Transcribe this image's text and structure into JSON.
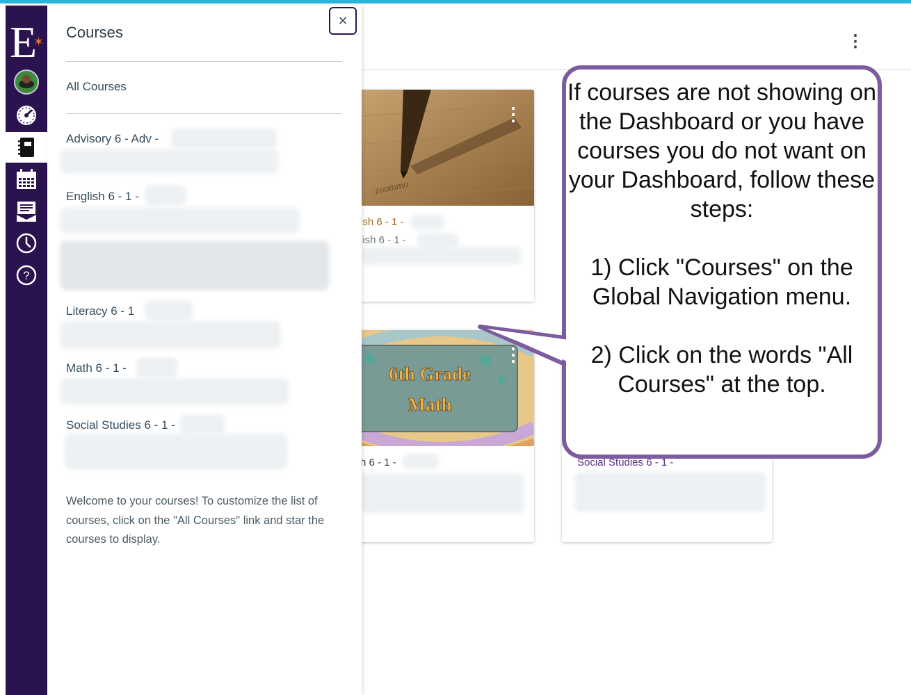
{
  "tray": {
    "title": "Courses",
    "close_label": "×",
    "all_courses": "All Courses",
    "courses": [
      "Advisory 6 - Adv -",
      "English 6 - 1 -",
      "Literacy 6 - 1",
      "Math 6 - 1 -",
      "Social Studies 6 - 1 -"
    ],
    "welcome": "Welcome to your courses! To customize the list of courses, click on the \"All Courses\" link and star the courses to display."
  },
  "nav": {
    "logo_letter": "E",
    "items": [
      "account-avatar",
      "dashboard-icon",
      "courses-icon",
      "calendar-icon",
      "inbox-icon",
      "history-icon",
      "help-icon"
    ],
    "active": "courses-icon",
    "colors": {
      "nav_bg": "#2b1350",
      "logo_star": "#e0792b",
      "accent_border": "#2ab4d9"
    }
  },
  "dashboard": {
    "kebab": "⋮",
    "cards": [
      {
        "label_primary": "ish 6 - 1 -",
        "label_secondary": "lish 6 - 1 -",
        "primary_color": "#a36b14"
      },
      {
        "banner_line1": "6th Grade",
        "banner_line2": "Math",
        "label_primary": "h 6 - 1 -",
        "primary_color": "#2d3b45"
      },
      {
        "label_primary": "Social Studies 6 - 1 -",
        "primary_color": "#5b2c83"
      }
    ]
  },
  "callout": {
    "text": "If courses are not showing on the Dashboard or you have courses you do not want on your Dashboard, follow these steps:\n\n1) Click \"Courses\" on the Global Navigation menu.\n\n2) Click on the words \"All Courses\" at the top.",
    "border_color": "#7c5c9e"
  }
}
